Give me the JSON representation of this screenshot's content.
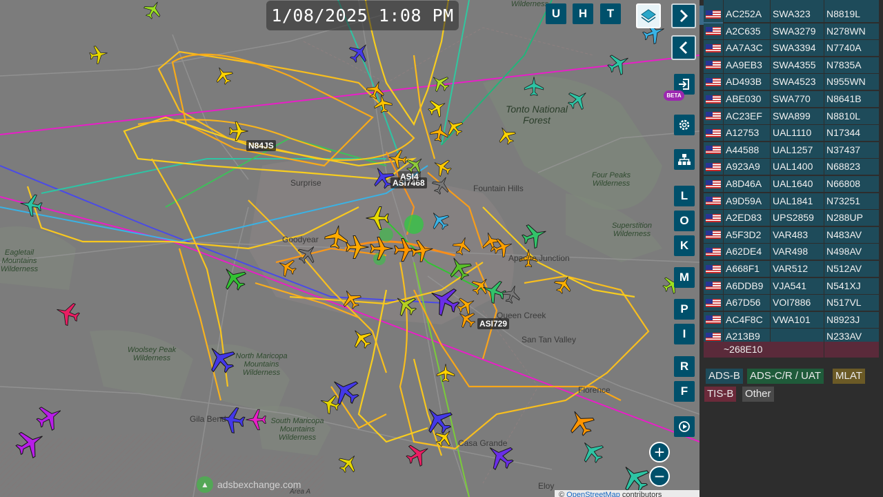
{
  "map": {
    "datetime": "1/08/2025 1:08 PM",
    "places": [
      {
        "name": "Tonto National Forest",
        "kind": "forest"
      },
      {
        "name": "Four Peaks Wilderness",
        "kind": "wild"
      },
      {
        "name": "Superstition Wilderness",
        "kind": "wild"
      },
      {
        "name": "Eagletail Mountains Wilderness",
        "kind": "wild"
      },
      {
        "name": "Woolsey Peak Wilderness",
        "kind": "wild"
      },
      {
        "name": "North Maricopa Mountains Wilderness",
        "kind": "wild"
      },
      {
        "name": "South Maricopa Mountains Wilderness",
        "kind": "wild"
      },
      {
        "name": "Surprise",
        "kind": "city"
      },
      {
        "name": "Goodyear",
        "kind": "city"
      },
      {
        "name": "Fountain Hills",
        "kind": "city"
      },
      {
        "name": "Apache Junction",
        "kind": "city"
      },
      {
        "name": "Queen Creek",
        "kind": "city"
      },
      {
        "name": "San Tan Valley",
        "kind": "city"
      },
      {
        "name": "Casa Grande",
        "kind": "city"
      },
      {
        "name": "Gila Bend",
        "kind": "city"
      },
      {
        "name": "Florence",
        "kind": "city"
      },
      {
        "name": "Eloy",
        "kind": "city"
      },
      {
        "name": "Area A",
        "kind": "city"
      },
      {
        "name": "Wilderness",
        "kind": "wild"
      }
    ],
    "callsigns": [
      "N84JS",
      "ASI7468",
      "ASI4",
      "ASI729"
    ],
    "logo_text": "adsbexchange.com",
    "attribution_prefix": "©",
    "attribution_link": "OpenStreetMap",
    "attribution_suffix": "contributors"
  },
  "controls": {
    "top_buttons": [
      "U",
      "H",
      "T"
    ],
    "side_letters": [
      "L",
      "O",
      "K",
      "M",
      "P",
      "I",
      "R",
      "F"
    ],
    "beta_label": "BETA",
    "icons": {
      "layers": "layers-icon",
      "next": "chevron-right-icon",
      "prev": "chevron-left-icon",
      "login": "login-icon",
      "settings": "gear-icon",
      "hierarchy": "sitemap-icon",
      "replay": "replay-icon",
      "zoom_in": "plus-icon",
      "zoom_out": "minus-icon",
      "expand": "expand-arrows-icon"
    }
  },
  "aircraft_table": {
    "rows": [
      {
        "hex": "AC252A",
        "callsign": "SWA323",
        "reg": "N8819L"
      },
      {
        "hex": "A2C635",
        "callsign": "SWA3279",
        "reg": "N278WN"
      },
      {
        "hex": "AA7A3C",
        "callsign": "SWA3394",
        "reg": "N7740A"
      },
      {
        "hex": "AA9EB3",
        "callsign": "SWA4355",
        "reg": "N7835A"
      },
      {
        "hex": "AD493B",
        "callsign": "SWA4523",
        "reg": "N955WN"
      },
      {
        "hex": "ABE030",
        "callsign": "SWA770",
        "reg": "N8641B"
      },
      {
        "hex": "AC23EF",
        "callsign": "SWA899",
        "reg": "N8810L"
      },
      {
        "hex": "A12753",
        "callsign": "UAL1110",
        "reg": "N17344"
      },
      {
        "hex": "A44588",
        "callsign": "UAL1257",
        "reg": "N37437"
      },
      {
        "hex": "A923A9",
        "callsign": "UAL1400",
        "reg": "N68823"
      },
      {
        "hex": "A8D46A",
        "callsign": "UAL1640",
        "reg": "N66808"
      },
      {
        "hex": "A9D59A",
        "callsign": "UAL1841",
        "reg": "N73251"
      },
      {
        "hex": "A2ED83",
        "callsign": "UPS2859",
        "reg": "N288UP"
      },
      {
        "hex": "A5F3D2",
        "callsign": "VAR483",
        "reg": "N483AV"
      },
      {
        "hex": "A62DE4",
        "callsign": "VAR498",
        "reg": "N498AV"
      },
      {
        "hex": "A668F1",
        "callsign": "VAR512",
        "reg": "N512AV"
      },
      {
        "hex": "A6DDB9",
        "callsign": "VJA541",
        "reg": "N541XJ"
      },
      {
        "hex": "A67D56",
        "callsign": "VOI7886",
        "reg": "N517VL"
      },
      {
        "hex": "AC4F8C",
        "callsign": "VWA101",
        "reg": "N8923J"
      },
      {
        "hex": "A213B9",
        "callsign": "",
        "reg": "N233AV"
      }
    ],
    "tisb_row": {
      "hex": "~268E10"
    }
  },
  "legend": [
    {
      "label": "ADS-B",
      "color": "#1e4b5a"
    },
    {
      "label": "ADS-C/R / UAT",
      "color": "#1f5b3a"
    },
    {
      "label": "MLAT",
      "color": "#6b5a26"
    },
    {
      "label": "TIS-B",
      "color": "#6b2a3a"
    },
    {
      "label": "Other",
      "color": "#4a4a4a"
    }
  ]
}
